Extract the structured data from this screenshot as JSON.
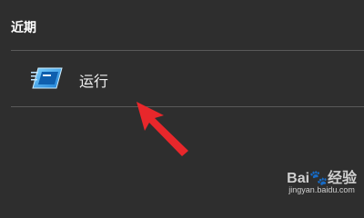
{
  "section": {
    "title": "近期"
  },
  "result": {
    "label": "运行",
    "icon": "run-dialog-icon"
  },
  "watermark": {
    "brand_left": "Bai",
    "brand_right": "经验",
    "url": "jingyan.baidu.com"
  },
  "colors": {
    "background": "#2e2e2e",
    "arrow": "#e8272b",
    "divider": "#5a5a5a"
  }
}
